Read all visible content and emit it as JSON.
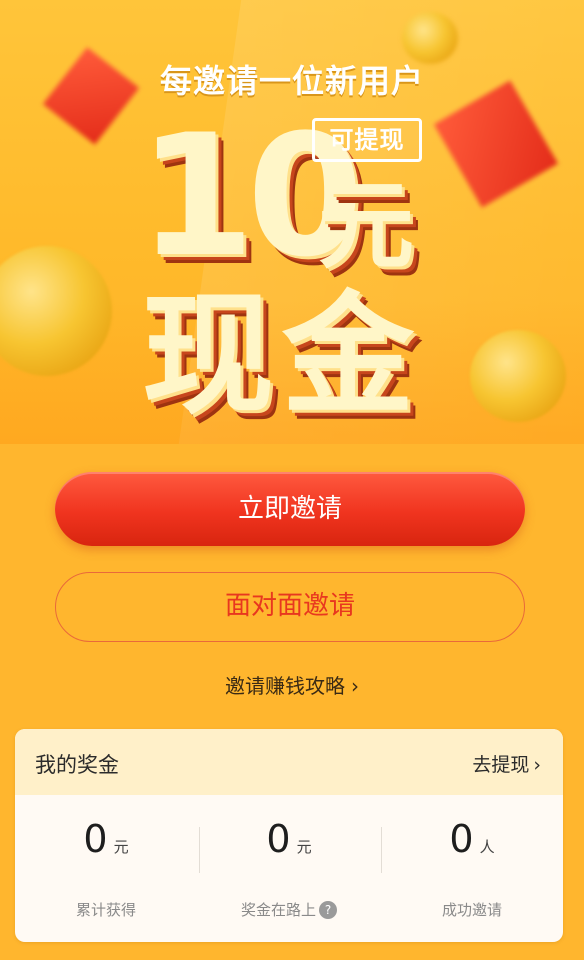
{
  "hero": {
    "subtitle": "每邀请一位新用户",
    "amount": "10",
    "currency": "元",
    "badge": "可提现",
    "cash": "现金"
  },
  "actions": {
    "invite_now": "立即邀请",
    "face_to_face": "面对面邀请",
    "strategy": "邀请赚钱攻略",
    "chevron": "›"
  },
  "bonus": {
    "title": "我的奖金",
    "withdraw": "去提现",
    "chevron": "›",
    "stats": [
      {
        "value": "0",
        "unit": "元",
        "label": "累计获得"
      },
      {
        "value": "0",
        "unit": "元",
        "label": "奖金在路上",
        "help": "?"
      },
      {
        "value": "0",
        "unit": "人",
        "label": "成功邀请"
      }
    ]
  },
  "icons": {
    "help": "question-icon",
    "chevron": "chevron-right-icon"
  },
  "colors": {
    "background": "#ffb62e",
    "primary_button": "#f0341f",
    "secondary_text": "#e8371f",
    "card_header": "#fff0c9"
  }
}
